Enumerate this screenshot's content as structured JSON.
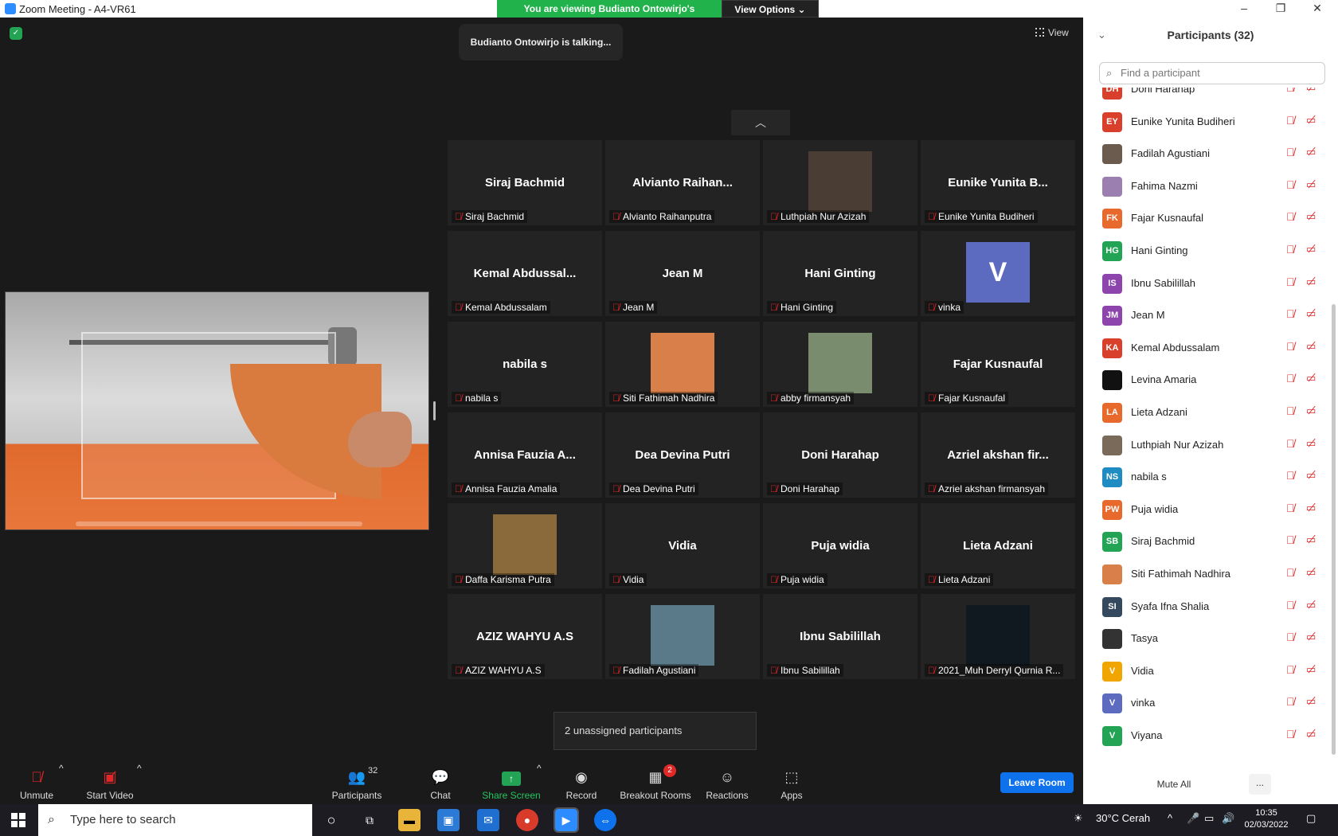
{
  "window": {
    "title": "Zoom Meeting - A4-VR61"
  },
  "banner": {
    "viewing": "You are viewing Budianto Ontowirjo's screen",
    "view_options": "View Options ⌄"
  },
  "meeting": {
    "talking": "Budianto Ontowirjo is talking...",
    "view_label": "View",
    "unassigned": "2 unassigned participants"
  },
  "tiles": [
    {
      "big": "Siraj Bachmid",
      "name": "Siraj Bachmid",
      "photo": ""
    },
    {
      "big": "Alvianto  Raihan...",
      "name": "Alvianto Raihanputra",
      "photo": ""
    },
    {
      "big": "",
      "name": "Luthpiah Nur Azizah",
      "photo": "face-photo"
    },
    {
      "big": "Eunike  Yunita  B...",
      "name": "Eunike Yunita Budiheri",
      "photo": ""
    },
    {
      "big": "Kemal  Abdussal...",
      "name": "Kemal Abdussalam",
      "photo": ""
    },
    {
      "big": "Jean M",
      "name": "Jean M",
      "photo": ""
    },
    {
      "big": "Hani Ginting",
      "name": "Hani Ginting",
      "photo": ""
    },
    {
      "big": "",
      "name": "vinka",
      "photo": "V"
    },
    {
      "big": "nabila s",
      "name": "nabila s",
      "photo": ""
    },
    {
      "big": "",
      "name": "Siti Fathimah Nadhira",
      "photo": "anime-avatar"
    },
    {
      "big": "",
      "name": "abby firmansyah",
      "photo": "selfie-photo"
    },
    {
      "big": "Fajar Kusnaufal",
      "name": "Fajar Kusnaufal",
      "photo": ""
    },
    {
      "big": "Annisa  Fauzia  A...",
      "name": "Annisa Fauzia Amalia",
      "photo": ""
    },
    {
      "big": "Dea Devina Putri",
      "name": "Dea Devina Putri",
      "photo": ""
    },
    {
      "big": "Doni Harahap",
      "name": "Doni Harahap",
      "photo": ""
    },
    {
      "big": "Azriel  akshan  fir...",
      "name": "Azriel akshan firmansyah",
      "photo": ""
    },
    {
      "big": "",
      "name": "Daffa Karisma Putra",
      "photo": "portrait-photo"
    },
    {
      "big": "Vidia",
      "name": "Vidia",
      "photo": ""
    },
    {
      "big": "Puja widia",
      "name": "Puja widia",
      "photo": ""
    },
    {
      "big": "Lieta Adzani",
      "name": "Lieta Adzani",
      "photo": ""
    },
    {
      "big": "AZIZ WAHYU A.S",
      "name": "AZIZ WAHYU A.S",
      "photo": ""
    },
    {
      "big": "",
      "name": "Fadilah Agustiani",
      "photo": "illustration"
    },
    {
      "big": "Ibnu Sabilillah",
      "name": "Ibnu Sabilillah",
      "photo": ""
    },
    {
      "big": "",
      "name": "2021_Muh Derryl Qurnia R...",
      "photo": "dark-photo"
    }
  ],
  "toolbar": {
    "unmute": "Unmute",
    "start_video": "Start Video",
    "participants": "Participants",
    "participants_count": "32",
    "chat": "Chat",
    "share_screen": "Share Screen",
    "record": "Record",
    "breakout": "Breakout Rooms",
    "breakout_badge": "2",
    "reactions": "Reactions",
    "apps": "Apps",
    "leave_room": "Leave Room"
  },
  "panel": {
    "title": "Participants (32)",
    "search_placeholder": "Find a participant",
    "mute_all": "Mute All",
    "more": "...",
    "participants": [
      {
        "initials": "DH",
        "name": "Doni Harahap",
        "color": "#d9402b"
      },
      {
        "initials": "EY",
        "name": "Eunike Yunita Budiheri",
        "color": "#d9402b"
      },
      {
        "initials": "",
        "name": "Fadilah Agustiani",
        "color": "#6b5a4e"
      },
      {
        "initials": "",
        "name": "Fahima Nazmi",
        "color": "#9a7fb0"
      },
      {
        "initials": "FK",
        "name": "Fajar Kusnaufal",
        "color": "#e8692c"
      },
      {
        "initials": "HG",
        "name": "Hani Ginting",
        "color": "#23a455"
      },
      {
        "initials": "IS",
        "name": "Ibnu Sabilillah",
        "color": "#8e44ad"
      },
      {
        "initials": "JM",
        "name": "Jean M",
        "color": "#8e44ad"
      },
      {
        "initials": "KA",
        "name": "Kemal Abdussalam",
        "color": "#d9402b"
      },
      {
        "initials": "",
        "name": "Levina Amaria",
        "color": "#111111"
      },
      {
        "initials": "LA",
        "name": "Lieta Adzani",
        "color": "#e8692c"
      },
      {
        "initials": "",
        "name": "Luthpiah Nur Azizah",
        "color": "#7a6a5a"
      },
      {
        "initials": "NS",
        "name": "nabila s",
        "color": "#1e8bc3"
      },
      {
        "initials": "PW",
        "name": "Puja widia",
        "color": "#e8692c"
      },
      {
        "initials": "SB",
        "name": "Siraj Bachmid",
        "color": "#23a455"
      },
      {
        "initials": "",
        "name": "Siti Fathimah Nadhira",
        "color": "#d9804a"
      },
      {
        "initials": "SI",
        "name": "Syafa Ifna Shalia",
        "color": "#34495e"
      },
      {
        "initials": "",
        "name": "Tasya",
        "color": "#333333"
      },
      {
        "initials": "V",
        "name": "Vidia",
        "color": "#f0a500"
      },
      {
        "initials": "V",
        "name": "vinka",
        "color": "#5c6bc0"
      },
      {
        "initials": "V",
        "name": "Viyana",
        "color": "#23a455"
      }
    ]
  },
  "taskbar": {
    "search_placeholder": "Type here to search",
    "weather": "30°C  Cerah",
    "time": "10:35",
    "date": "02/03/2022"
  },
  "colors": {
    "accent": "#0e72ed",
    "share_green": "#23a455",
    "muted_red": "#e02828"
  }
}
